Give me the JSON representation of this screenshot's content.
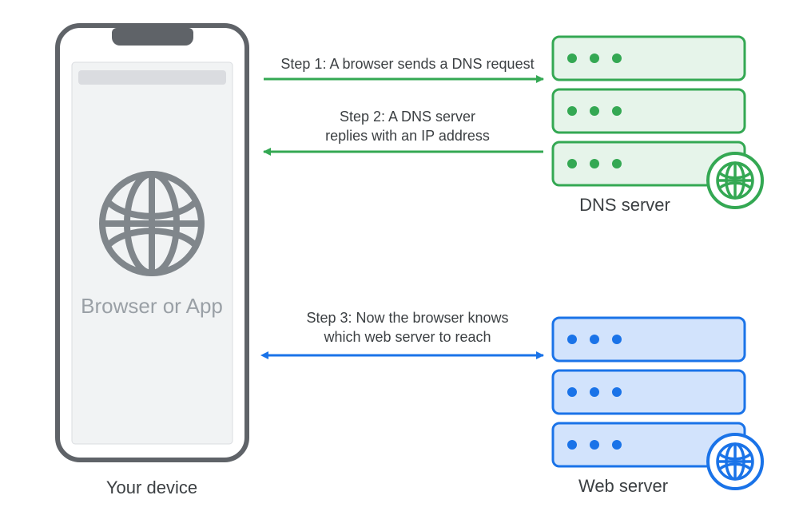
{
  "device": {
    "label": "Your device",
    "browser_text": "Browser or App"
  },
  "dns": {
    "label": "DNS server"
  },
  "web": {
    "label": "Web server"
  },
  "steps": {
    "s1": "Step 1: A browser sends a DNS request",
    "s2a": "Step 2: A DNS server",
    "s2b": "replies with an IP address",
    "s3a": "Step 3: Now the browser knows",
    "s3b": "which web server to reach"
  },
  "colors": {
    "phone_outline": "#5f6368",
    "phone_screen": "#f1f3f4",
    "phone_bar": "#dadce0",
    "globe_gray": "#80868b",
    "green_stroke": "#34a853",
    "green_fill": "#e6f4ea",
    "green_dot": "#34a853",
    "blue_stroke": "#1a73e8",
    "blue_fill": "#d2e3fc",
    "blue_dot": "#1a73e8"
  }
}
